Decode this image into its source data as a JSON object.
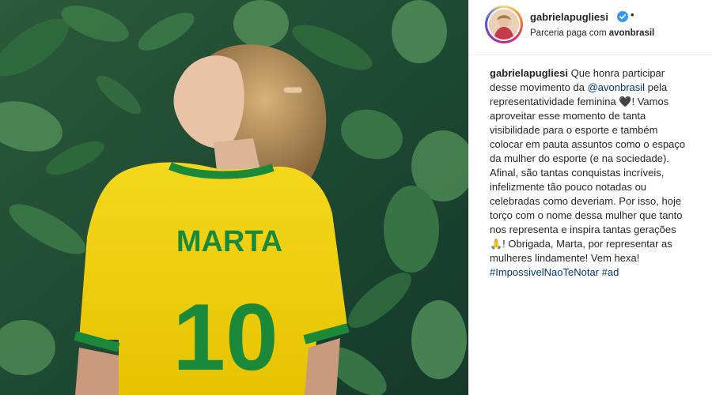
{
  "post": {
    "username": "gabrielapugliesi",
    "verified": true,
    "separator": "•",
    "partnership_prefix": "Parceria paga com",
    "partner": "avonbrasil"
  },
  "photo": {
    "jersey_name": "MARTA",
    "jersey_number": "10",
    "jersey_color": "#f2d400",
    "trim_color": "#1a8a3a",
    "background_color": "#1e4a33"
  },
  "caption": {
    "username": "gabrielapugliesi",
    "lines": [
      "Que honra participar",
      "desse movimento da",
      "pela",
      "representatividade feminina 🖤! Vamos",
      "aproveitar esse momento de tanta",
      "visibilidade para o esporte e também",
      "colocar em pauta assuntos como o espaço",
      "da mulher do esporte (e na sociedade).",
      "Afinal, são tantas conquistas incríveis,",
      "infelizmente tão pouco notadas ou",
      "celebradas como deveriam. Por isso, hoje",
      "torço com o nome dessa mulher que tanto",
      "nos representa e inspira tantas gerações",
      "🙏! Obrigada, Marta, por representar as",
      "mulheres lindamente! Vem hexa!"
    ],
    "mention": "@avonbrasil",
    "hashtags": "#ImpossivelNaoTeNotar #ad"
  }
}
